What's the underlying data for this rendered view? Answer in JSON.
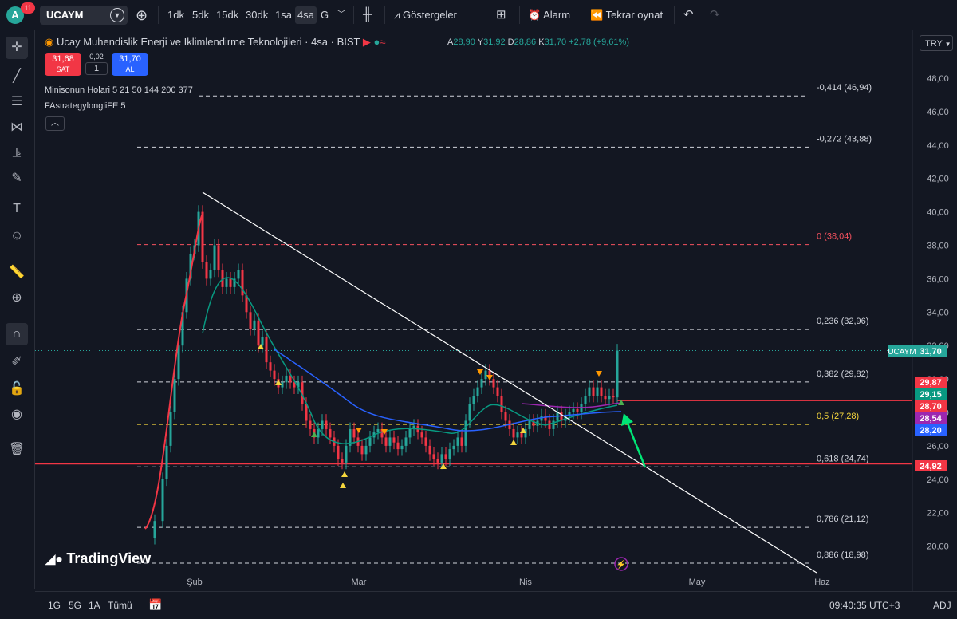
{
  "header": {
    "avatar_letter": "A",
    "notification_count": "11",
    "symbol": "UCAYM",
    "timeframes": [
      "1dk",
      "5dk",
      "15dk",
      "30dk",
      "1sa",
      "4sa",
      "G"
    ],
    "active_timeframe": "4sa",
    "indicators_label": "Göstergeler",
    "alarm_label": "Alarm",
    "replay_label": "Tekrar oynat"
  },
  "legend": {
    "title": "Ucay Muhendislik Enerji ve Iklimlendirme Teknolojileri · 4sa · BIST",
    "ohlc": {
      "o_label": "A",
      "o": "28,90",
      "h_label": "Y",
      "h": "31,92",
      "l_label": "D",
      "l": "28,86",
      "c_label": "K",
      "c": "31,70",
      "change": "+2,78 (+9,61%)"
    },
    "sell_price": "31,68",
    "sell_label": "SAT",
    "spread": "0,02",
    "quantity": "1",
    "buy_price": "31,70",
    "buy_label": "AL",
    "indicator1": "Minisonun Holari 5 21 50 144 200 377",
    "indicator2": "FAstrategylongliFE 5"
  },
  "currency": "TRY",
  "price_axis": [
    "48,00",
    "46,00",
    "44,00",
    "42,00",
    "40,00",
    "38,00",
    "36,00",
    "34,00",
    "32,00",
    "30,00",
    "28,00",
    "26,00",
    "24,00",
    "22,00",
    "20,00"
  ],
  "fib_levels": [
    {
      "label": "-0,414 (46,94)",
      "value": 46.94,
      "color": "#d1d4dc"
    },
    {
      "label": "-0,272 (43,88)",
      "value": 43.88,
      "color": "#d1d4dc"
    },
    {
      "label": "0 (38,04)",
      "value": 38.04,
      "color": "#f7525f"
    },
    {
      "label": "0,236 (32,96)",
      "value": 32.96,
      "color": "#d1d4dc"
    },
    {
      "label": "0,382 (29,82)",
      "value": 29.82,
      "color": "#d1d4dc"
    },
    {
      "label": "0,5 (27,28)",
      "value": 27.28,
      "color": "#f5d63d"
    },
    {
      "label": "0,618 (24,74)",
      "value": 24.74,
      "color": "#d1d4dc"
    },
    {
      "label": "0,786 (21,12)",
      "value": 21.12,
      "color": "#d1d4dc"
    },
    {
      "label": "0,886 (18,98)",
      "value": 18.98,
      "color": "#d1d4dc"
    }
  ],
  "price_tags": [
    {
      "label": "31,70",
      "value": 31.7,
      "color": "#26a69a"
    },
    {
      "label": "29,87",
      "value": 29.87,
      "color": "#f23645"
    },
    {
      "label": "29,15",
      "value": 29.15,
      "color": "#089981"
    },
    {
      "label": "28,70",
      "value": 28.7,
      "color": "#f23645"
    },
    {
      "label": "28,54",
      "value": 28.54,
      "color": "#9c27b0"
    },
    {
      "label": "28,20",
      "value": 28.2,
      "color": "#2962ff"
    },
    {
      "label": "24,92",
      "value": 24.92,
      "color": "#f23645"
    }
  ],
  "symbol_tag": "UCAYM",
  "time_axis": [
    "Şub",
    "Mar",
    "Nis",
    "May",
    "Haz"
  ],
  "bottom": {
    "ranges": [
      "1G",
      "5G",
      "1A",
      "Tümü"
    ],
    "clock": "09:40:35 UTC+3",
    "adj": "ADJ"
  },
  "brand": "TradingView"
}
